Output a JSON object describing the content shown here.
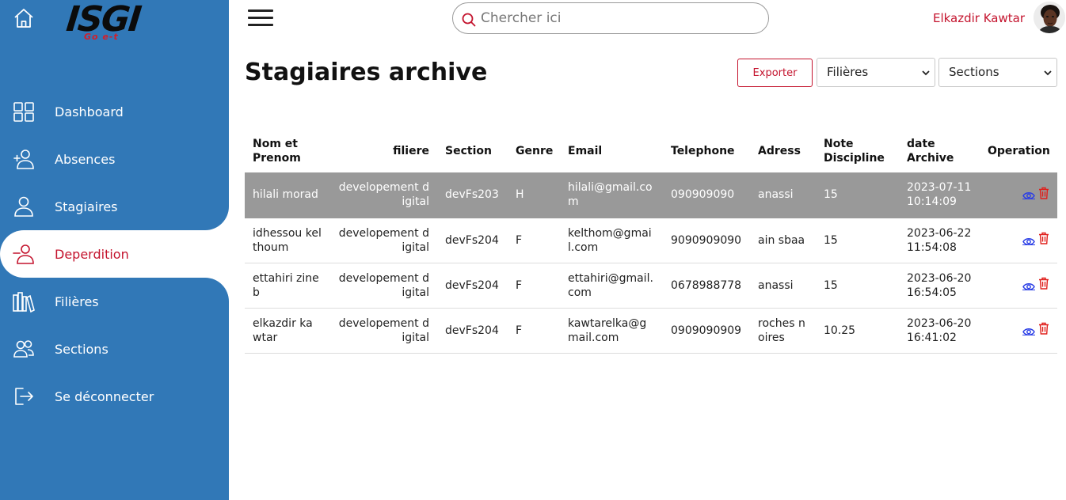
{
  "app": {
    "logo_text": "ISGI",
    "logo_sub": "Go e-t"
  },
  "sidebar": {
    "items": [
      {
        "label": "Dashboard",
        "icon": "grid-icon"
      },
      {
        "label": "Absences",
        "icon": "user-plus-icon"
      },
      {
        "label": "Stagiaires",
        "icon": "user-icon"
      },
      {
        "label": "Deperdition",
        "icon": "user-minus-icon",
        "active": true
      },
      {
        "label": "Filières",
        "icon": "books-icon"
      },
      {
        "label": "Sections",
        "icon": "users-icon"
      },
      {
        "label": "Se déconnecter",
        "icon": "logout-icon"
      }
    ]
  },
  "header": {
    "search_placeholder": "Chercher ici",
    "user_name": "Elkazdir Kawtar"
  },
  "main": {
    "title": "Stagiaires archive",
    "export_label": "Exporter",
    "filter_filieres": "Filières",
    "filter_sections": "Sections"
  },
  "table": {
    "columns": [
      "Nom et Prenom",
      "filiere",
      "Section",
      "Genre",
      "Email",
      "Telephone",
      "Adress",
      "Note Discipline",
      "date Archive",
      "Operation"
    ],
    "rows": [
      {
        "nom": "hilali morad",
        "filiere": "developement digital",
        "section": "devFs203",
        "genre": "H",
        "email": "hilali@gmail.com",
        "telephone": "090909090",
        "adress": "anassi",
        "note": "15",
        "date": "2023-07-11 10:14:09"
      },
      {
        "nom": "idhessou kelthoum",
        "filiere": "developement digital",
        "section": "devFs204",
        "genre": "F",
        "email": "kelthom@gmail.com",
        "telephone": "9090909090",
        "adress": "ain sbaa",
        "note": "15",
        "date": "2023-06-22 11:54:08"
      },
      {
        "nom": "ettahiri zineb",
        "filiere": "developement digital",
        "section": "devFs204",
        "genre": "F",
        "email": "ettahiri@gmail.com",
        "telephone": "0678988778",
        "adress": "anassi",
        "note": "15",
        "date": "2023-06-20 16:54:05"
      },
      {
        "nom": "elkazdir kawtar",
        "filiere": "developement digital",
        "section": "devFs204",
        "genre": "F",
        "email": "kawtarelka@gmail.com",
        "telephone": "0909090909",
        "adress": "roches noires",
        "note": "10.25",
        "date": "2023-06-20 16:41:02"
      }
    ]
  },
  "colors": {
    "sidebar_bg": "#3178b7",
    "accent_red": "#c4142e",
    "selected_row": "#999999",
    "view_icon": "#2a3ee6",
    "delete_icon": "#e0201c"
  }
}
